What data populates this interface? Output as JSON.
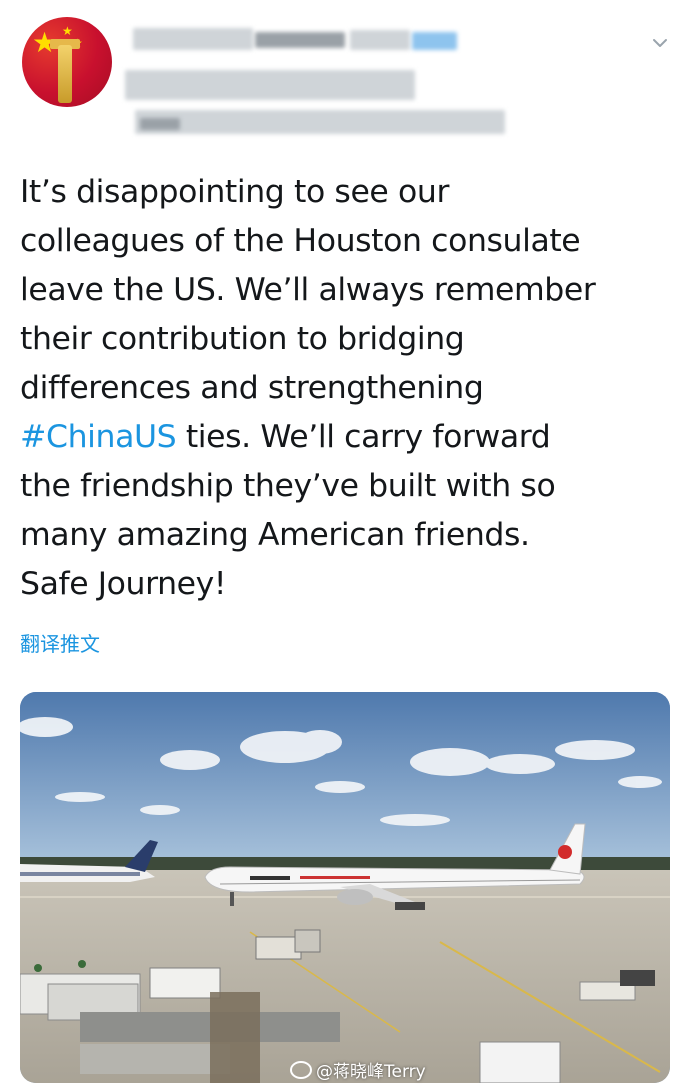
{
  "tweet": {
    "lines_before": [
      "It’s disappointing to see our",
      "colleagues of the Houston consulate",
      "leave the US. We’ll always remember",
      "their contribution to bridging",
      "differences and strengthening"
    ],
    "hashtag": "#ChinaUS",
    "hashtag_tail": " ties. We’ll carry forward",
    "lines_after": [
      "the friendship they’ve built with so",
      "many amazing American friends.",
      "Safe Journey!"
    ]
  },
  "translate_label": "翻译推文",
  "watermark": "@蒋晓峰Terry",
  "colors": {
    "hashtag": "#1b95e0",
    "text": "#14171a",
    "link": "#1b95e0"
  },
  "icons": {
    "menu": "chevron-down-icon",
    "watermark": "weibo-logo-icon"
  }
}
